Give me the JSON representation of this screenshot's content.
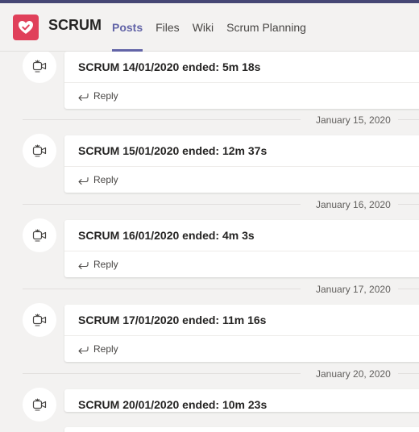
{
  "header": {
    "team_name": "SCRUM",
    "tabs": [
      {
        "label": "Posts",
        "active": true
      },
      {
        "label": "Files",
        "active": false
      },
      {
        "label": "Wiki",
        "active": false
      },
      {
        "label": "Scrum Planning",
        "active": false
      }
    ]
  },
  "colors": {
    "accent": "#6264a7",
    "team_icon": "#e0405a",
    "top_bar": "#464775"
  },
  "feed": {
    "reply_label": "Reply",
    "dates": [
      "January 15, 2020",
      "January 16, 2020",
      "January 17, 2020",
      "January 20, 2020"
    ],
    "posts": [
      {
        "text": "SCRUM 14/01/2020 ended: 5m 18s",
        "icon": "meeting-video-icon"
      },
      {
        "text": "SCRUM 15/01/2020 ended: 12m 37s",
        "icon": "meeting-video-icon"
      },
      {
        "text": "SCRUM 16/01/2020 ended: 4m 3s",
        "icon": "meeting-video-icon"
      },
      {
        "text": "SCRUM 17/01/2020 ended: 11m 16s",
        "icon": "meeting-video-icon"
      },
      {
        "text": "SCRUM 20/01/2020 ended: 10m 23s",
        "icon": "meeting-video-icon"
      }
    ]
  }
}
